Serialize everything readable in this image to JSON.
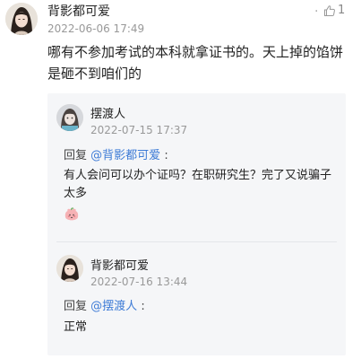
{
  "comment": {
    "author": "背影都可爱",
    "time": "2022-06-06 17:49",
    "more_icon": "more-dots-icon",
    "more_glyph": "·",
    "like_icon": "thumbs-up-icon",
    "likes": "1",
    "text": "哪有不参加考试的本科就拿证书的。天上掉的馅饼是砸不到咱们的"
  },
  "replies": [
    {
      "author": "摆渡人",
      "time": "2022-07-15 17:37",
      "reply_prefix": "回复",
      "reply_to": "@背影都可爱",
      "reply_colon": ":",
      "text": "有人会问可以办个证吗？在职研究生？完了又说骗子太多",
      "emoji": "peach-face-emoji"
    },
    {
      "author": "背影都可爱",
      "time": "2022-07-16 13:44",
      "reply_prefix": "回复",
      "reply_to": "@摆渡人",
      "reply_colon": ":",
      "text": "正常"
    }
  ],
  "colors": {
    "link": "#3d7bd6",
    "panel_bg": "#f5f6f8",
    "time": "#999999"
  }
}
